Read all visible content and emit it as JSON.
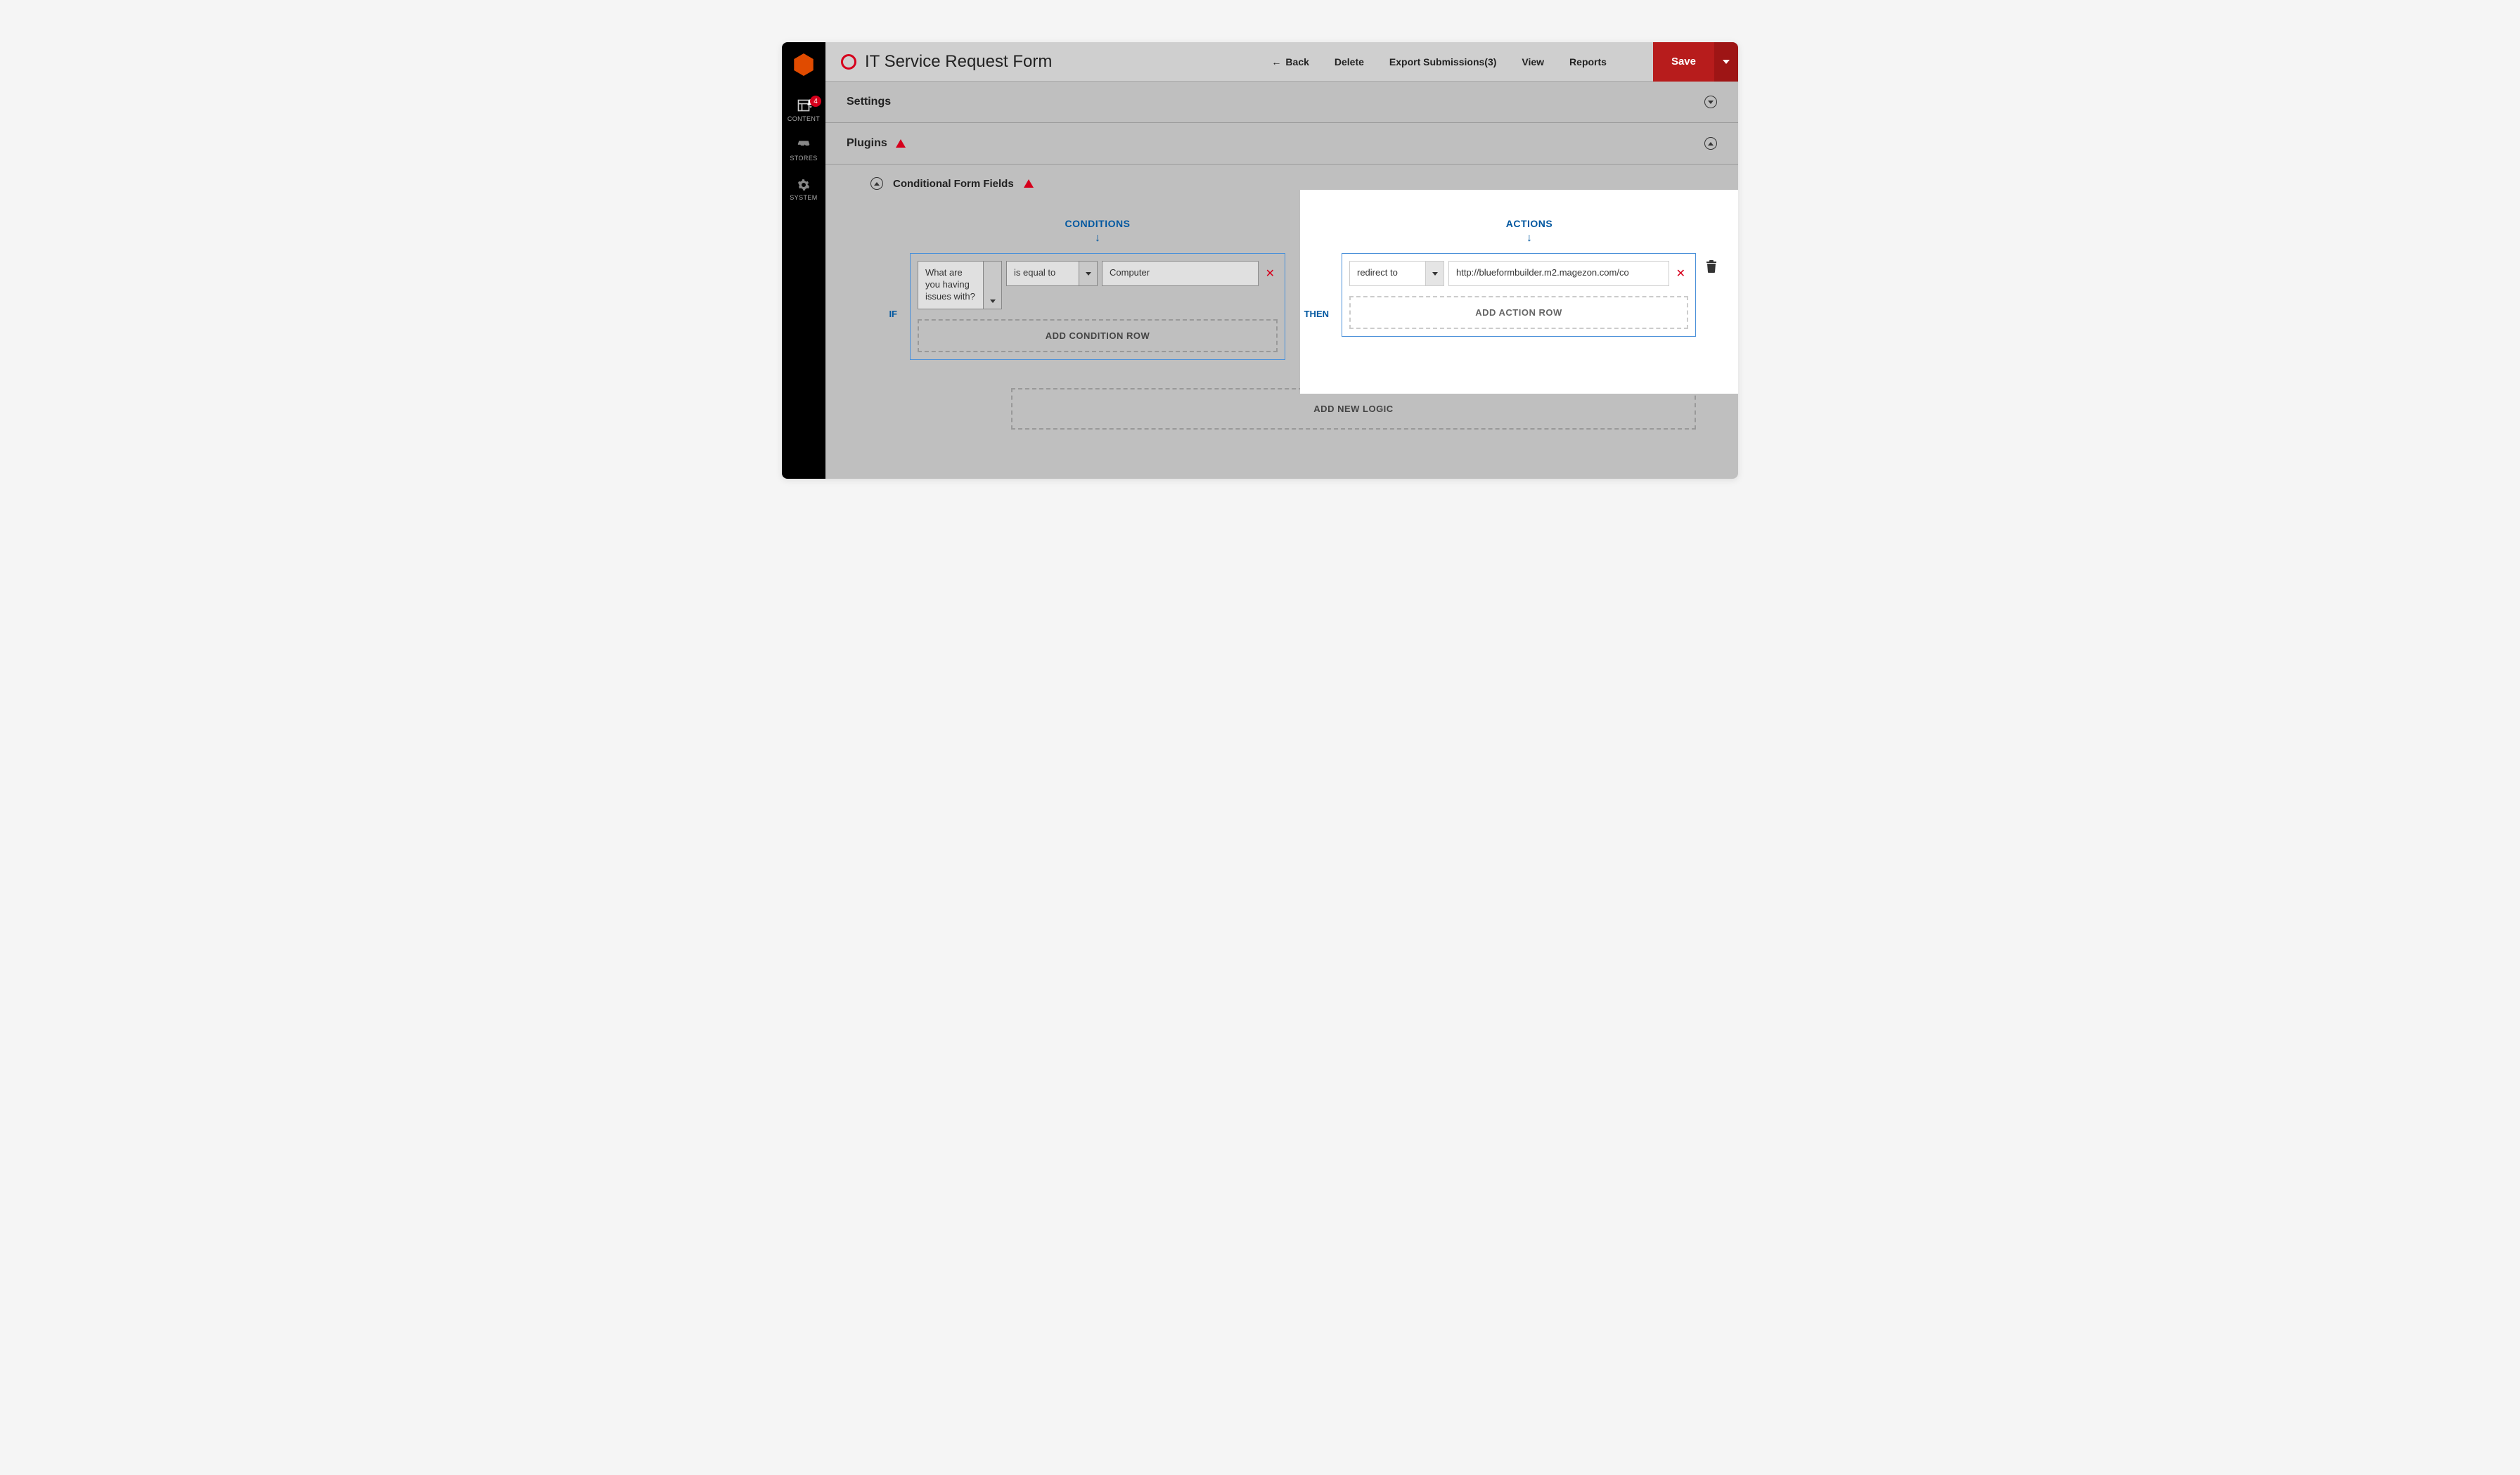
{
  "sidebar": {
    "items": [
      {
        "label": "CONTENT",
        "badge": "4",
        "bell": true
      },
      {
        "label": "STORES"
      },
      {
        "label": "SYSTEM"
      }
    ]
  },
  "header": {
    "title": "IT Service Request Form",
    "back": "Back",
    "delete": "Delete",
    "export": "Export Submissions(3)",
    "view": "View",
    "reports": "Reports",
    "save": "Save"
  },
  "panels": {
    "settings": "Settings",
    "plugins": "Plugins",
    "conditional": "Conditional Form Fields"
  },
  "logic": {
    "conditions_label": "CONDITIONS",
    "actions_label": "ACTIONS",
    "if": "IF",
    "then": "THEN",
    "condition": {
      "field": "What are you having issues with?",
      "operator": "is equal to",
      "value": "Computer"
    },
    "action": {
      "type": "redirect to",
      "value": "http://blueformbuilder.m2.magezon.com/co"
    },
    "add_condition": "ADD CONDITION ROW",
    "add_action": "ADD ACTION ROW",
    "add_logic": "ADD NEW LOGIC"
  }
}
